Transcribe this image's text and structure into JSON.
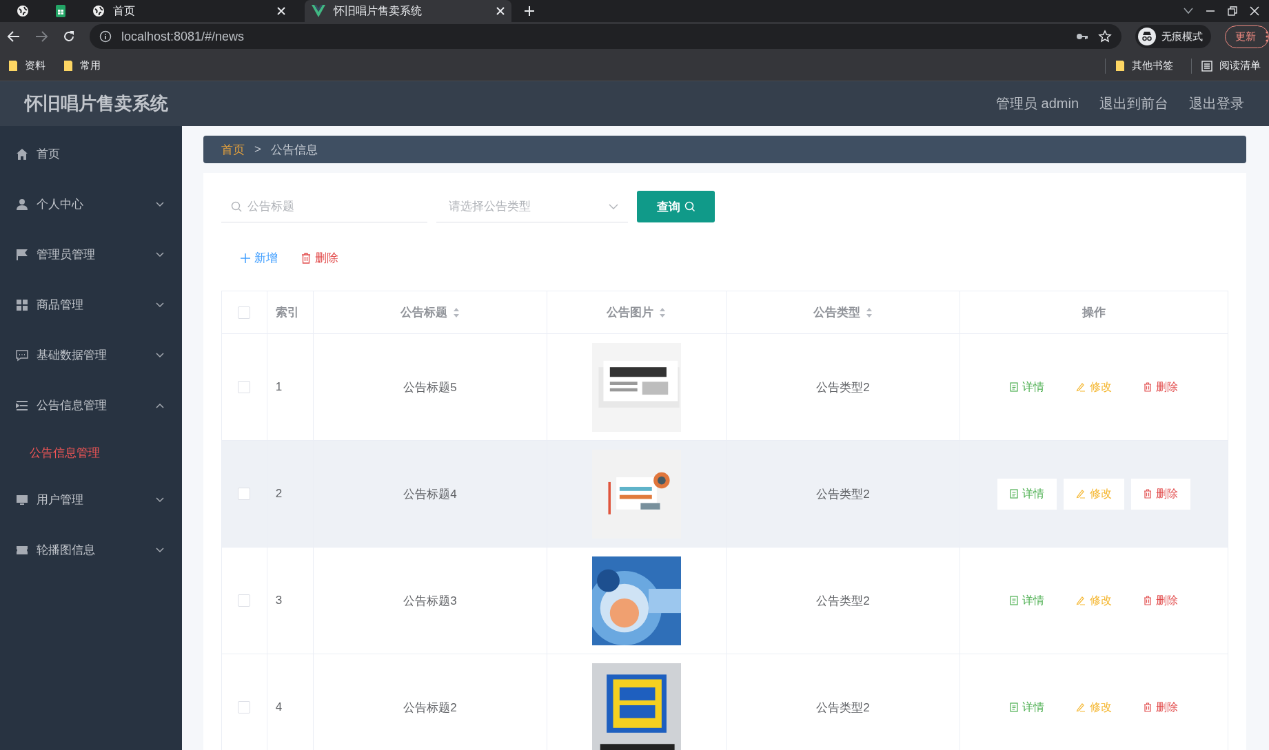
{
  "browser": {
    "tabs": [
      {
        "kind": "globe",
        "selected": false,
        "closable": false
      },
      {
        "kind": "sheet",
        "selected": false,
        "closable": false
      },
      {
        "kind": "globe",
        "title": "首页",
        "selected": false,
        "closable": true
      },
      {
        "kind": "vue",
        "title": "怀旧唱片售卖系统",
        "selected": true,
        "closable": true
      }
    ],
    "address": "localhost:8081/#/news",
    "incognito_label": "无痕模式",
    "update_button": "更新",
    "bookmarks_left": [
      "资料",
      "常用"
    ],
    "bookmarks_right": [
      {
        "kind": "folder",
        "label": "其他书签"
      },
      {
        "kind": "reading",
        "label": "阅读清单"
      }
    ]
  },
  "header": {
    "title": "怀旧唱片售卖系统",
    "user": "管理员 admin",
    "links": [
      "退出到前台",
      "退出登录"
    ]
  },
  "sidebar": {
    "items": [
      {
        "label": "首页"
      },
      {
        "label": "个人中心",
        "expanded": false
      },
      {
        "label": "管理员管理",
        "expanded": false
      },
      {
        "label": "商品管理",
        "expanded": false
      },
      {
        "label": "基础数据管理",
        "expanded": false
      },
      {
        "label": "公告信息管理",
        "expanded": true,
        "children": [
          {
            "label": "公告信息管理",
            "selected": true
          }
        ]
      },
      {
        "label": "用户管理",
        "expanded": false
      },
      {
        "label": "轮播图信息",
        "expanded": false
      }
    ]
  },
  "breadcrumb": [
    {
      "label": "首页",
      "kind": "link"
    },
    {
      "label": ">",
      "kind": "separator"
    },
    {
      "label": "公告信息",
      "kind": "current"
    }
  ],
  "search": {
    "title_placeholder": "公告标题",
    "type_placeholder": "请选择公告类型",
    "button": "查询"
  },
  "toolbar": [
    {
      "kind": "add",
      "label": "新增"
    },
    {
      "kind": "delete",
      "label": "删除"
    }
  ],
  "table": {
    "select_all_checked": false,
    "columns": [
      {
        "label": "索引",
        "sortable": false
      },
      {
        "label": "公告标题",
        "sortable": true
      },
      {
        "label": "公告图片",
        "sortable": true
      },
      {
        "label": "公告类型",
        "sortable": true
      },
      {
        "label": "操作",
        "sortable": false
      }
    ],
    "rows": [
      {
        "checked": false,
        "highlighted": false,
        "index": "1",
        "title": "公告标题5",
        "image": {
          "kind": "picture"
        },
        "type": "公告类型2",
        "actions": [
          {
            "kind": "detail",
            "label": "详情"
          },
          {
            "kind": "edit",
            "label": "修改"
          },
          {
            "kind": "delete",
            "label": "删除"
          }
        ]
      },
      {
        "checked": false,
        "highlighted": true,
        "index": "2",
        "title": "公告标题4",
        "image": {
          "kind": "picture"
        },
        "type": "公告类型2",
        "actions": [
          {
            "kind": "detail",
            "label": "详情"
          },
          {
            "kind": "edit",
            "label": "修改"
          },
          {
            "kind": "delete",
            "label": "删除"
          }
        ]
      },
      {
        "checked": false,
        "highlighted": false,
        "index": "3",
        "title": "公告标题3",
        "image": {
          "kind": "picture"
        },
        "type": "公告类型2",
        "actions": [
          {
            "kind": "detail",
            "label": "详情"
          },
          {
            "kind": "edit",
            "label": "修改"
          },
          {
            "kind": "delete",
            "label": "删除"
          }
        ]
      },
      {
        "checked": false,
        "highlighted": false,
        "index": "4",
        "title": "公告标题2",
        "image": {
          "kind": "picture"
        },
        "type": "公告类型2",
        "actions": [
          {
            "kind": "detail",
            "label": "详情"
          },
          {
            "kind": "edit",
            "label": "修改"
          },
          {
            "kind": "delete",
            "label": "删除"
          }
        ]
      }
    ]
  }
}
